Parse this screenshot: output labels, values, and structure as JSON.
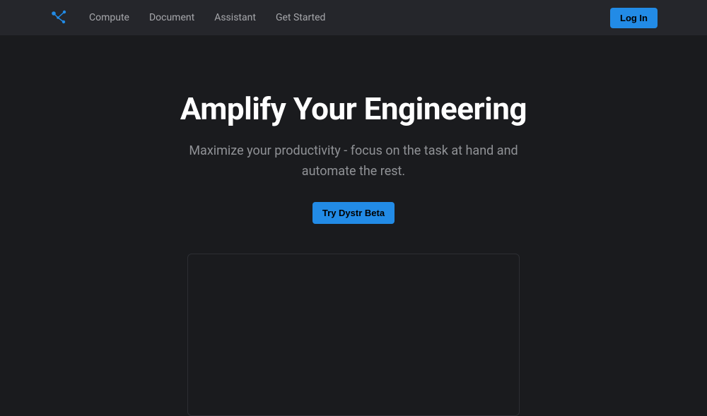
{
  "nav": {
    "links": [
      {
        "label": "Compute"
      },
      {
        "label": "Document"
      },
      {
        "label": "Assistant"
      },
      {
        "label": "Get Started"
      }
    ],
    "login_label": "Log In"
  },
  "hero": {
    "title": "Amplify Your Engineering",
    "subtitle": "Maximize your productivity - focus on the task at hand and automate the rest.",
    "cta_label": "Try Dystr Beta"
  },
  "colors": {
    "accent": "#228be6",
    "navbar_bg": "#25262b",
    "body_bg": "#1a1b1e",
    "muted_text": "#909296"
  }
}
